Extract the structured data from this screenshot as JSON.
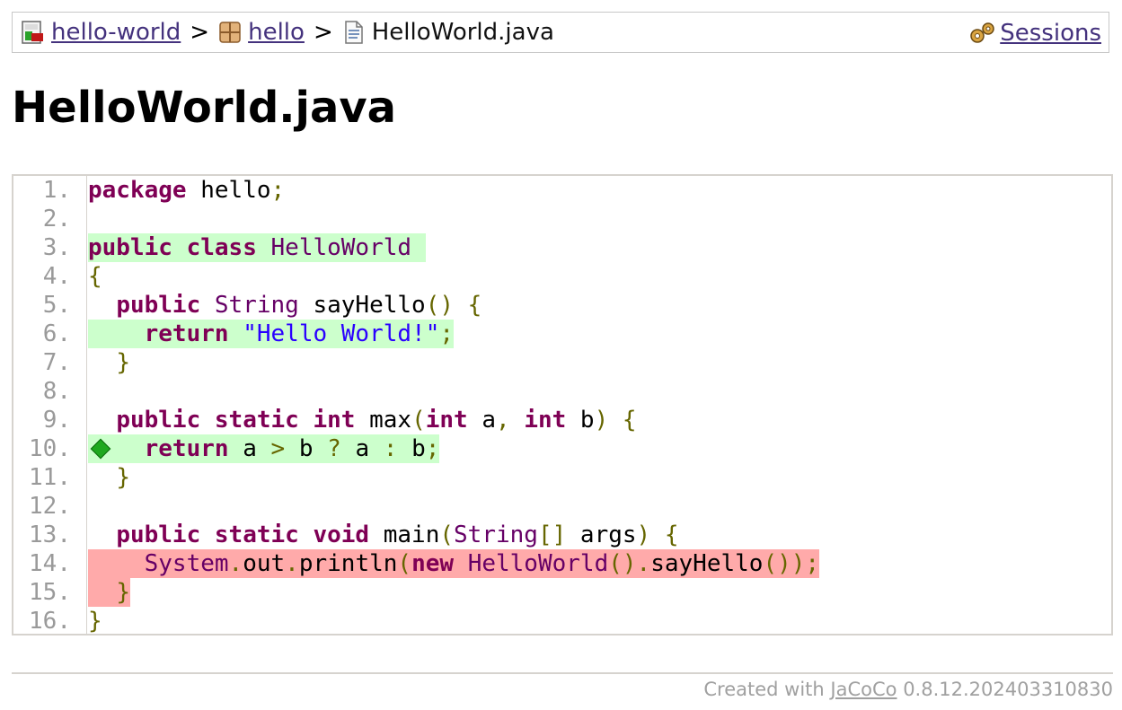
{
  "breadcrumb": {
    "items": [
      {
        "label": "hello-world",
        "icon": "report-icon"
      },
      {
        "label": "hello",
        "icon": "package-icon"
      },
      {
        "label": "HelloWorld.java",
        "icon": "source-file-icon"
      }
    ],
    "separator": ">",
    "sessions_label": "Sessions",
    "sessions_icon": "gears-icon"
  },
  "page_title": "HelloWorld.java",
  "code": {
    "line_numbers": [
      "1.",
      "2.",
      "3.",
      "4.",
      "5.",
      "6.",
      "7.",
      "8.",
      "9.",
      "10.",
      "11.",
      "12.",
      "13.",
      "14.",
      "15.",
      "16."
    ],
    "coverage_colors": {
      "covered": "#ccffcc",
      "not_covered": "#ffaaaa"
    },
    "lines": {
      "l1": {
        "t1": "package",
        "t2": " hello",
        "t3": ";"
      },
      "l3": {
        "t1": "public",
        "t2": " ",
        "t3": "class",
        "t4": " ",
        "t5": "HelloWorld",
        "t6": " "
      },
      "l4": {
        "t1": "{"
      },
      "l5": {
        "t1": "  ",
        "t2": "public",
        "t3": " ",
        "t4": "String",
        "t5": " sayHello",
        "t6": "()",
        "t7": " ",
        "t8": "{"
      },
      "l6": {
        "t1": "    ",
        "t2": "return",
        "t3": " ",
        "t4": "\"Hello World!\"",
        "t5": ";"
      },
      "l7": {
        "t1": "  ",
        "t2": "}"
      },
      "l9": {
        "t1": "  ",
        "t2": "public",
        "t3": " ",
        "t4": "static",
        "t5": " ",
        "t6": "int",
        "t7": " max",
        "t8": "(",
        "t9": "int",
        "t10": " a",
        "t11": ",",
        "t12": " ",
        "t13": "int",
        "t14": " b",
        "t15": ")",
        "t16": " ",
        "t17": "{"
      },
      "l10": {
        "t1": "    ",
        "t2": "return",
        "t3": " a ",
        "t4": ">",
        "t5": " b ",
        "t6": "?",
        "t7": " a ",
        "t8": ":",
        "t9": " b",
        "t10": ";"
      },
      "l11": {
        "t1": "  ",
        "t2": "}"
      },
      "l13": {
        "t1": "  ",
        "t2": "public",
        "t3": " ",
        "t4": "static",
        "t5": " ",
        "t6": "void",
        "t7": " main",
        "t8": "(",
        "t9": "String",
        "t10": "[]",
        "t11": " args",
        "t12": ")",
        "t13": " ",
        "t14": "{"
      },
      "l14": {
        "t1": "    ",
        "t2": "System",
        "t3": ".",
        "t4": "out",
        "t5": ".",
        "t6": "println",
        "t7": "(",
        "t8": "new",
        "t9": " ",
        "t10": "HelloWorld",
        "t11": "().",
        "t12": "sayHello",
        "t13": "());"
      },
      "l15": {
        "t1": "  ",
        "t2": "}"
      },
      "l16": {
        "t1": "}"
      }
    }
  },
  "footer": {
    "prefix": "Created with",
    "link": "JaCoCo",
    "version": "0.8.12.202403310830"
  }
}
